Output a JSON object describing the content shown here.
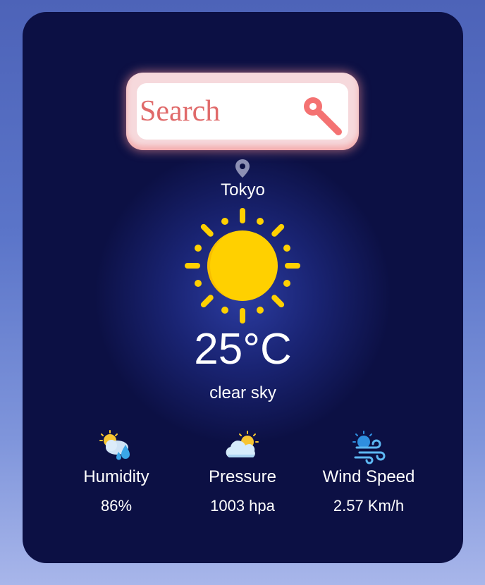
{
  "search": {
    "placeholder": "Search",
    "icon": "search-icon",
    "accent": "#f46f6f"
  },
  "location": {
    "icon": "map-pin-icon",
    "city": "Tokyo"
  },
  "weather": {
    "icon": "sun-icon",
    "temperature": "25°C",
    "description": "clear sky"
  },
  "stats": [
    {
      "icon": "humidity-icon",
      "label": "Humidity",
      "value": "86%"
    },
    {
      "icon": "pressure-icon",
      "label": "Pressure",
      "value": "1003 hpa"
    },
    {
      "icon": "wind-icon",
      "label": "Wind Speed",
      "value": "2.57 Km/h"
    }
  ],
  "colors": {
    "card": "#0c1044",
    "text": "#ffffff",
    "sun": "#ffd000"
  }
}
